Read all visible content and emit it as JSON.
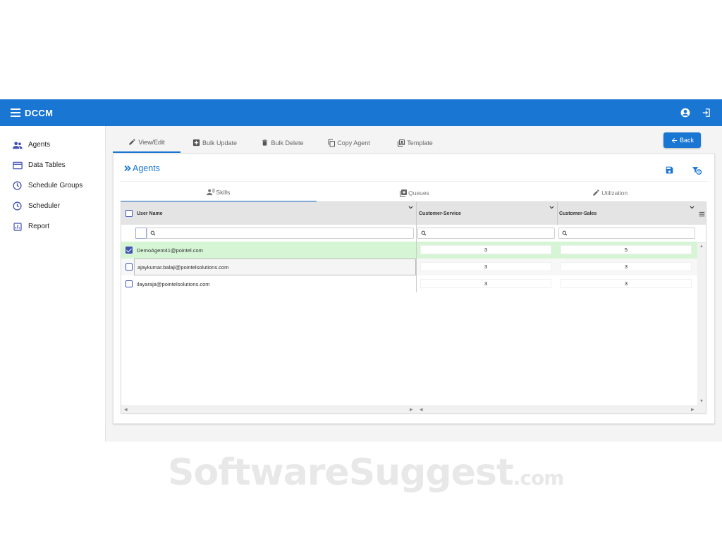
{
  "app": {
    "title": "DCCM"
  },
  "sidebar": {
    "items": [
      {
        "label": "Agents",
        "icon": "people-icon"
      },
      {
        "label": "Data Tables",
        "icon": "table-icon"
      },
      {
        "label": "Schedule Groups",
        "icon": "clock-icon"
      },
      {
        "label": "Scheduler",
        "icon": "clock-icon"
      },
      {
        "label": "Report",
        "icon": "bar-chart-icon"
      }
    ]
  },
  "toptabs": [
    {
      "label": "View/Edit",
      "icon": "pencil-icon",
      "active": true
    },
    {
      "label": "Bulk Update",
      "icon": "plus-box-icon"
    },
    {
      "label": "Bulk Delete",
      "icon": "trash-icon"
    },
    {
      "label": "Copy Agent",
      "icon": "copy-icon"
    },
    {
      "label": "Template",
      "icon": "template-icon"
    }
  ],
  "back_label": "Back",
  "card": {
    "title": "Agents"
  },
  "subtabs": [
    {
      "label": "Skills",
      "icon": "skills-icon",
      "active": true
    },
    {
      "label": "Queues",
      "icon": "queue-icon"
    },
    {
      "label": "Utilization",
      "icon": "pencil-icon"
    }
  ],
  "grid": {
    "columns": [
      "User Name",
      "Customer-Service",
      "Customer-Sales"
    ],
    "rows": [
      {
        "user": "DemoAgent41@pointel.com",
        "service": "3",
        "sales": "5",
        "checked": true
      },
      {
        "user": "ajaykumar.balaji@pointelsolutions.com",
        "service": "3",
        "sales": "3",
        "checked": false
      },
      {
        "user": "ilayaraja@pointelsolutions.com",
        "service": "3",
        "sales": "3",
        "checked": false
      }
    ]
  },
  "colors": {
    "primary": "#1976d2",
    "selected_row": "#d5f5d5",
    "checkbox": "#3f51b5"
  },
  "watermark": {
    "main": "SoftwareSuggest",
    "suffix": ".com"
  }
}
